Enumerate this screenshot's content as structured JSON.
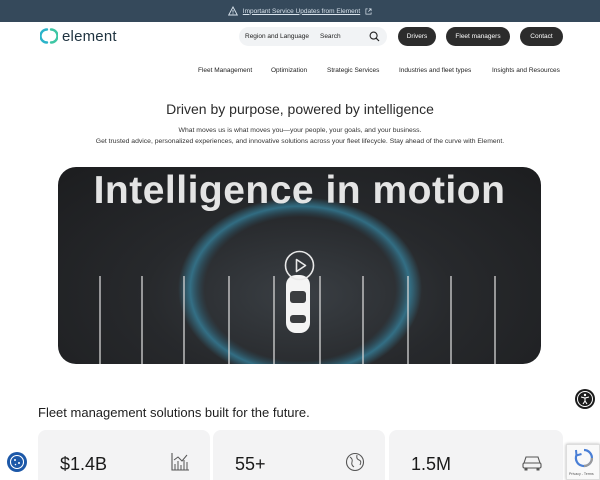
{
  "announcement": {
    "text": "Important Service Updates from Element",
    "icon": "warning-icon"
  },
  "header": {
    "logo_text": "element",
    "region_label": "Region and Language",
    "search_label": "Search",
    "buttons": {
      "drivers": "Drivers",
      "fleet_managers": "Fleet managers",
      "contact": "Contact"
    }
  },
  "nav": {
    "items": [
      "Fleet Management",
      "Optimization",
      "Strategic Services",
      "Industries and fleet types",
      "Insights and Resources"
    ]
  },
  "hero": {
    "title": "Driven by purpose, powered by intelligence",
    "subtitle_line1": "What moves us is what moves you—your people, your goals, and your business.",
    "subtitle_line2": "Get trusted advice, personalized experiences, and innovative solutions across your fleet lifecycle. Stay ahead of the curve with Element."
  },
  "video": {
    "heading": "Intelligence in motion"
  },
  "solutions": {
    "title": "Fleet management solutions built for the future.",
    "stats": [
      {
        "value": "$1.4B",
        "icon": "chart-icon"
      },
      {
        "value": "55+",
        "icon": "globe-icon"
      },
      {
        "value": "1.5M",
        "icon": "car-icon"
      }
    ]
  },
  "recaptcha": {
    "text": "Privacy - Terms"
  },
  "colors": {
    "announce_bg": "#35495b",
    "pill_bg": "#2c2c2c",
    "cookie_bg": "#1c58a8",
    "logo_teal": "#2bb3c9"
  }
}
